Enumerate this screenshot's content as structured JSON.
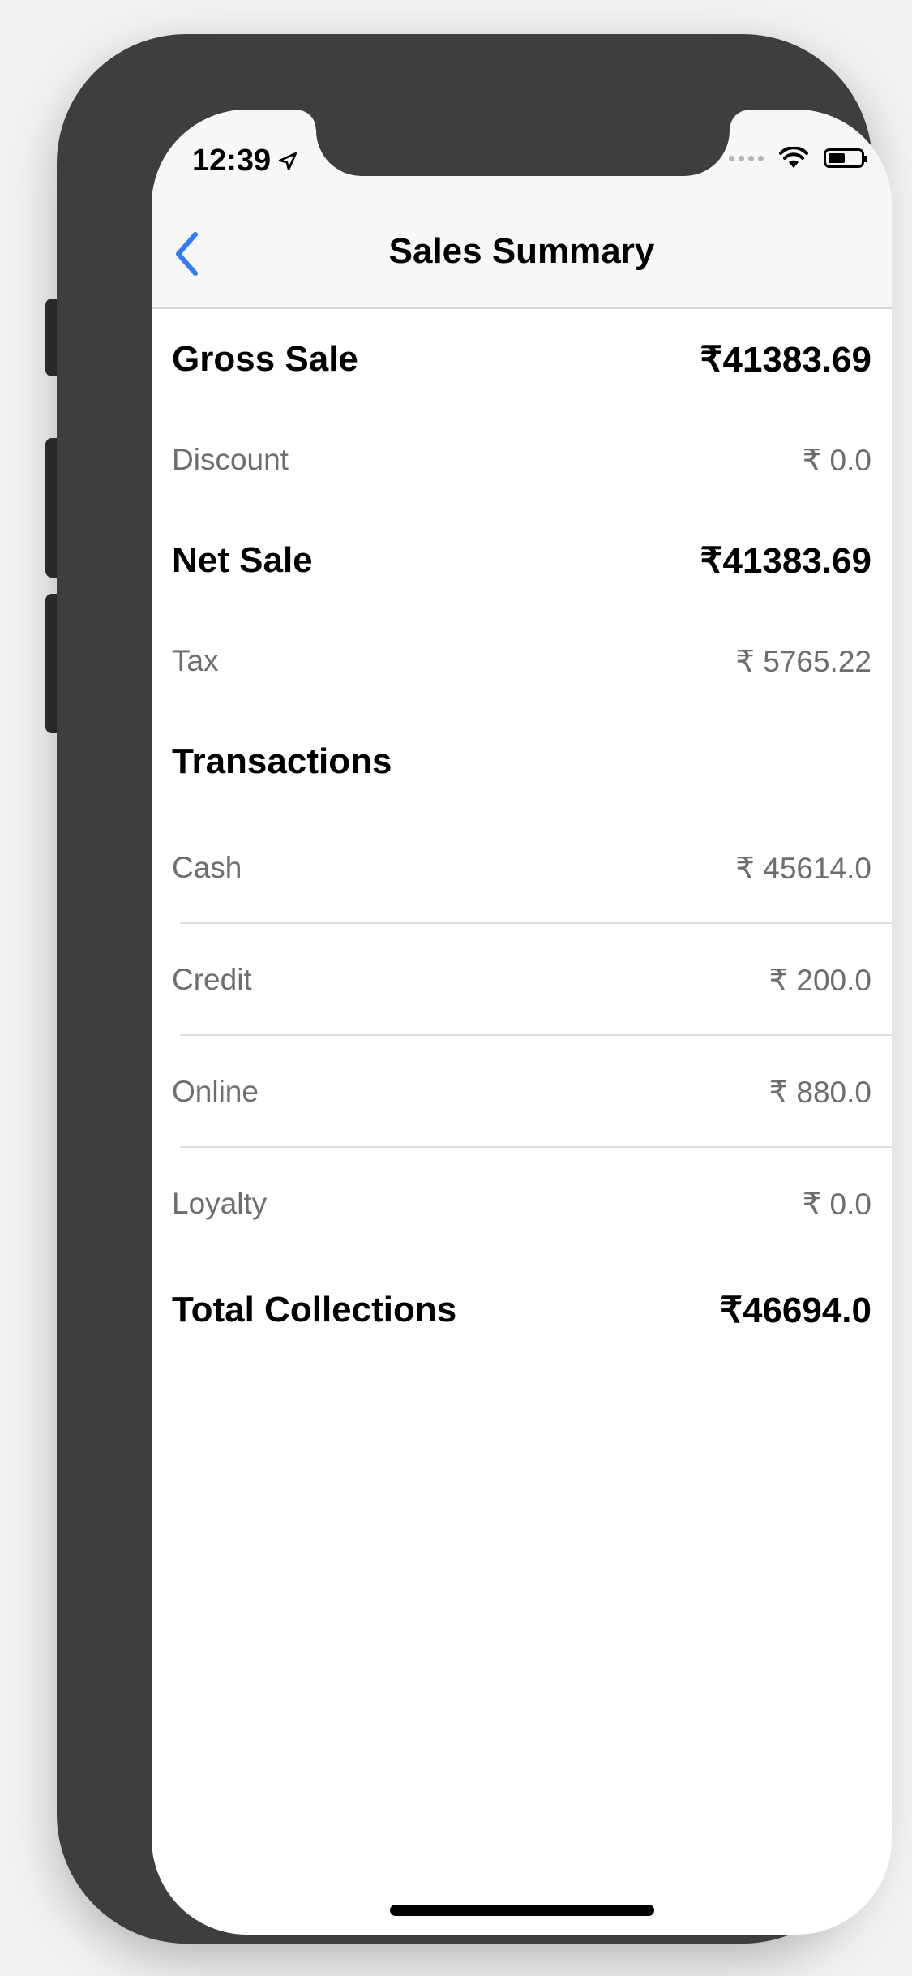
{
  "status_bar": {
    "time": "12:39"
  },
  "nav": {
    "title": "Sales Summary"
  },
  "summary": {
    "gross_sale_label": "Gross Sale",
    "gross_sale_value": "₹41383.69",
    "discount_label": "Discount",
    "discount_value": "₹ 0.0",
    "net_sale_label": "Net Sale",
    "net_sale_value": "₹41383.69",
    "tax_label": "Tax",
    "tax_value": "₹ 5765.22",
    "transactions_heading": "Transactions"
  },
  "transactions": [
    {
      "label": "Cash",
      "value": "₹ 45614.0"
    },
    {
      "label": "Credit",
      "value": "₹ 200.0"
    },
    {
      "label": "Online",
      "value": "₹ 880.0"
    },
    {
      "label": "Loyalty",
      "value": "₹ 0.0"
    }
  ],
  "totals": {
    "label": "Total Collections",
    "value": "₹46694.0"
  },
  "colors": {
    "accent": "#2f7cf6",
    "frame": "#3e3e3e",
    "secondary_text": "#6d6d6d"
  }
}
